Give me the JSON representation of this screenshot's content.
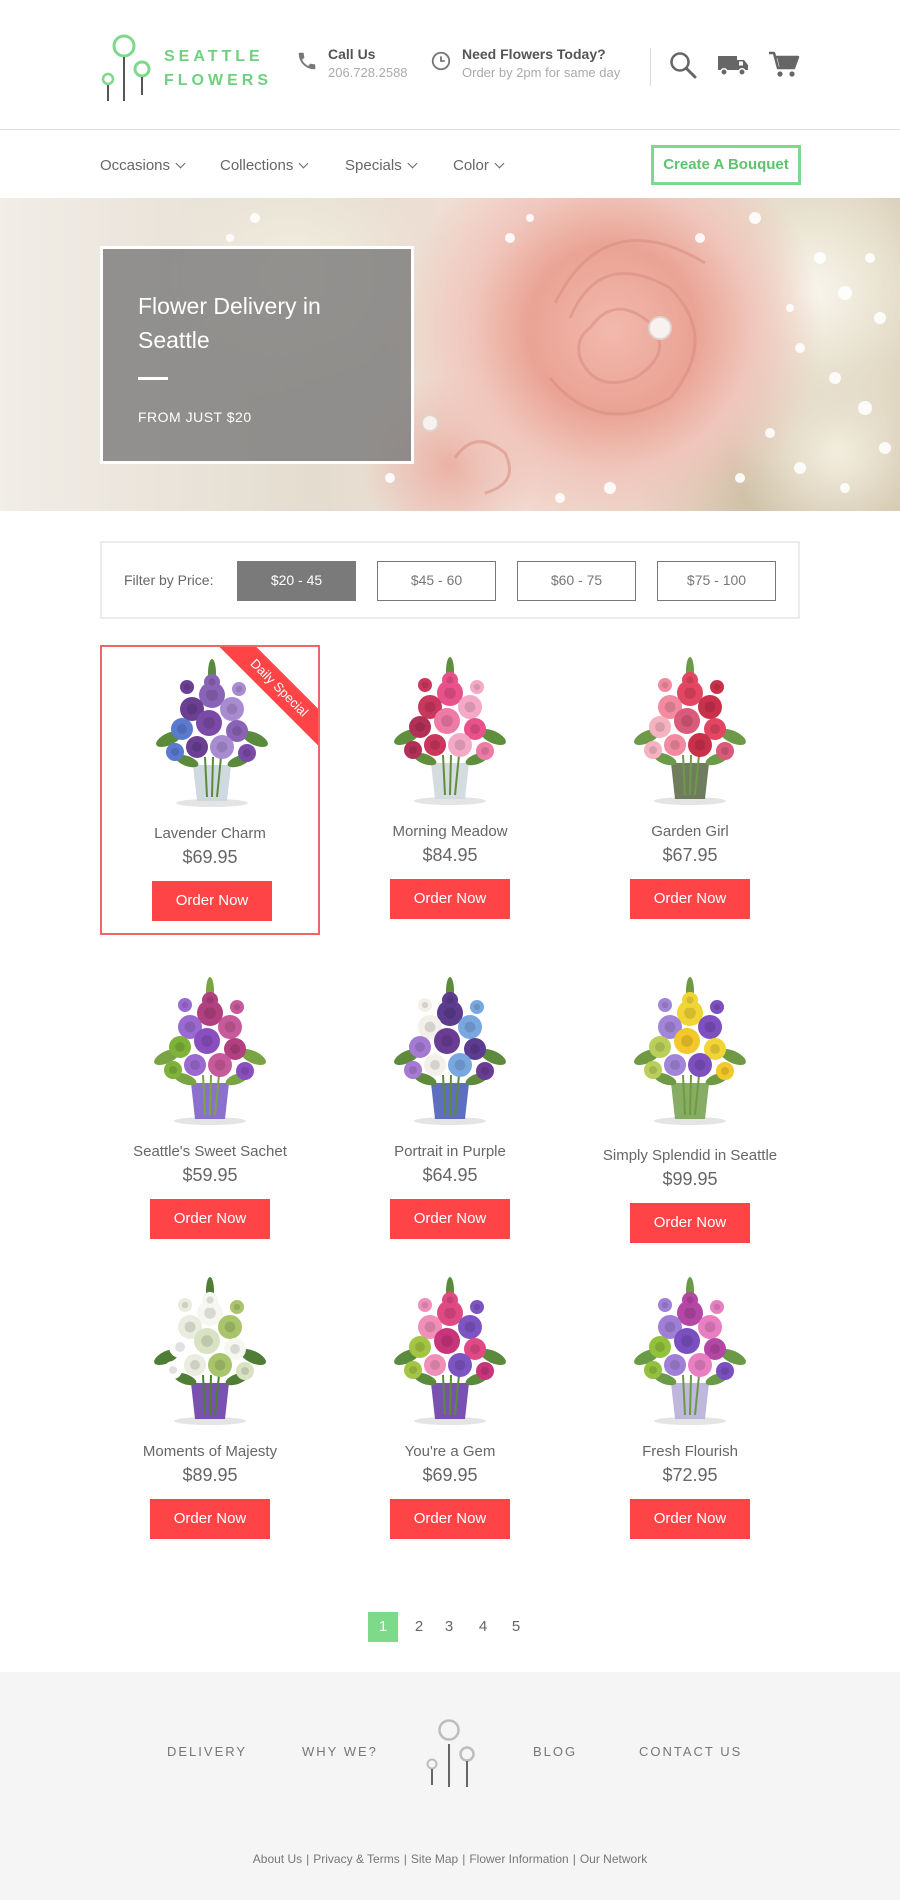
{
  "brand": {
    "line1": "SEATTLE",
    "line2": "FLOWERS",
    "color": "#6fd07f"
  },
  "header": {
    "call_title": "Call Us",
    "call_phone": "206.728.2588",
    "need_title": "Need Flowers Today?",
    "need_sub": "Order by 2pm for same day",
    "icons": [
      "search-icon",
      "delivery-truck-icon",
      "cart-icon"
    ]
  },
  "nav": {
    "items": [
      {
        "label": "Occasions"
      },
      {
        "label": "Collections"
      },
      {
        "label": "Specials"
      },
      {
        "label": "Color"
      }
    ],
    "cta": "Create A Bouquet"
  },
  "hero": {
    "title": "Flower Delivery in Seattle",
    "subtitle": "FROM JUST $20"
  },
  "filter": {
    "label": "Filter by Price:",
    "options": [
      "$20 - 45",
      "$45 - 60",
      "$60 - 75",
      "$75 - 100"
    ],
    "selected": "$20 - 45"
  },
  "products": [
    {
      "name": "Lavender Charm",
      "price": "$69.95",
      "cta": "Order Now",
      "badge": "Daily Special"
    },
    {
      "name": "Morning Meadow",
      "price": "$84.95",
      "cta": "Order Now"
    },
    {
      "name": "Garden Girl",
      "price": "$67.95",
      "cta": "Order Now"
    },
    {
      "name": "Seattle's Sweet Sachet",
      "price": "$59.95",
      "cta": "Order Now"
    },
    {
      "name": "Portrait in Purple",
      "price": "$64.95",
      "cta": "Order Now"
    },
    {
      "name": "Simply Splendid in Seattle",
      "price": "$99.95",
      "cta": "Order Now"
    },
    {
      "name": "Moments of Majesty",
      "price": "$89.95",
      "cta": "Order Now"
    },
    {
      "name": "You're a Gem",
      "price": "$69.95",
      "cta": "Order Now"
    },
    {
      "name": "Fresh Flourish",
      "price": "$72.95",
      "cta": "Order Now"
    }
  ],
  "pagination": {
    "pages": [
      "1",
      "2",
      "3",
      "4",
      "5"
    ],
    "current": "1"
  },
  "footer": {
    "links": [
      "DELIVERY",
      "WHY WE?",
      "BLOG",
      "CONTACT US"
    ],
    "bottom_links": [
      "About Us",
      "Privacy & Terms",
      "Site Map",
      "Flower Information",
      "Our Network"
    ],
    "separator": "|"
  },
  "colors": {
    "accent_green": "#7ed98b",
    "order_red": "#ff4447",
    "special_border": "#f26469"
  }
}
